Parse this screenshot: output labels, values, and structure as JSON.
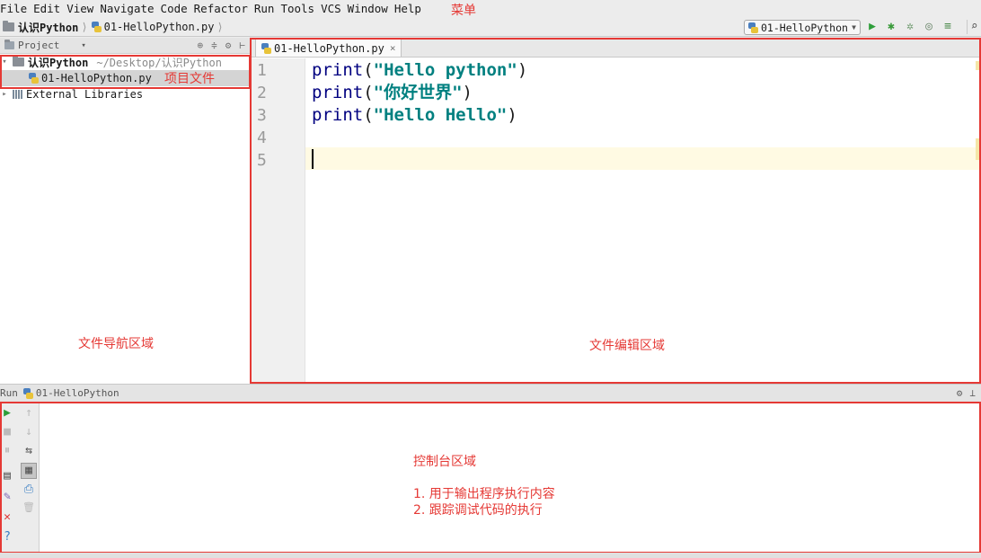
{
  "menu": {
    "items": [
      "File",
      "Edit",
      "View",
      "Navigate",
      "Code",
      "Refactor",
      "Run",
      "Tools",
      "VCS",
      "Window",
      "Help"
    ],
    "annotation": "菜单"
  },
  "navbar": {
    "project": "认识Python",
    "file": "01-HelloPython.py",
    "sep": "⟩"
  },
  "toolbar": {
    "run_config": "01-HelloPython",
    "run_icon": "▶",
    "debug_icon": "✱",
    "coverage_icon": "✲",
    "profile_icon": "◎",
    "build_icon": "≡",
    "search_icon": "⌕"
  },
  "project_panel": {
    "title": "Project",
    "title_caret": "▾",
    "header_icons": [
      "⊕",
      "≑",
      "⚙",
      "⊢"
    ],
    "root_name": "认识Python",
    "root_path": "~/Desktop/认识Python",
    "file_name": "01-HelloPython.py",
    "external": "External Libraries",
    "expand_open": "▾",
    "expand_closed": "▸",
    "annotation_files": "项目文件",
    "annotation_nav": "文件导航区域"
  },
  "editor": {
    "tab_label": "01-HelloPython.py",
    "tab_close": "×",
    "line_numbers": [
      "1",
      "2",
      "3",
      "4",
      "5"
    ],
    "lines": [
      {
        "func": "print",
        "open": "(",
        "string": "\"Hello python\"",
        "close": ")"
      },
      {
        "func": "print",
        "open": "(",
        "string": "\"你好世界\"",
        "close": ")"
      },
      {
        "func": "print",
        "open": "(",
        "string": "\"Hello Hello\"",
        "close": ")"
      }
    ],
    "annotation": "文件编辑区域"
  },
  "run_panel": {
    "label": "Run",
    "config": "01-HelloPython",
    "right_icons": [
      "⚙",
      "⊥"
    ],
    "tools_left": [
      "▶",
      "■",
      "⏸",
      "▤",
      "✎",
      "✕",
      "?"
    ],
    "tools_right": [
      "↑",
      "↓",
      "⇆",
      "▦",
      "⎙",
      "🗑"
    ],
    "annotation_title": "控制台区域",
    "annotation_line1": "1. 用于输出程序执行内容",
    "annotation_line2": "2. 跟踪调试代码的执行"
  },
  "colors": {
    "annotation": "#e53935",
    "keyword": "#000080",
    "string": "#008080",
    "current_line": "#fffae3",
    "run_green": "#2e9e3a"
  }
}
